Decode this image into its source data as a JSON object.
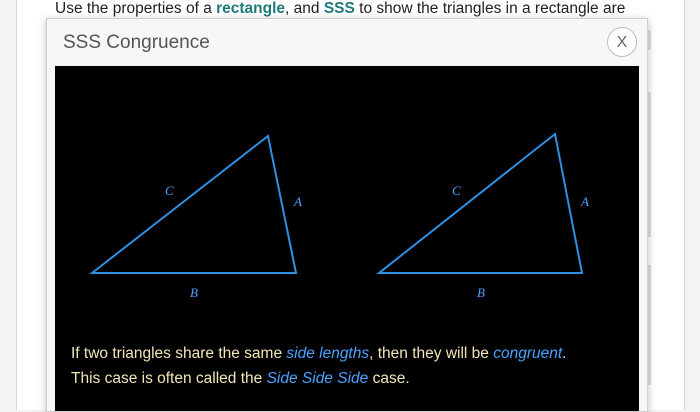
{
  "background": {
    "instruction_prefix": "Use the properties of a ",
    "keyword_rectangle": "rectangle",
    "instruction_mid": ", and ",
    "keyword_sss": "SSS",
    "instruction_suffix": " to show the triangles in a rectangle are"
  },
  "modal": {
    "title": "SSS Congruence",
    "close_label": "X"
  },
  "figure": {
    "triangles": [
      {
        "side_c": "C",
        "side_a": "A",
        "side_b": "B"
      },
      {
        "side_c": "C",
        "side_a": "A",
        "side_b": "B"
      }
    ],
    "stroke_color": "#2f8fe0"
  },
  "caption": {
    "part1": "If two triangles share the same ",
    "em1": "side lengths",
    "part2": ", then they will be ",
    "em2": "congruent",
    "part3": ".",
    "part4": "This case is often called the ",
    "em3": "Side Side Side",
    "part5": " case."
  }
}
